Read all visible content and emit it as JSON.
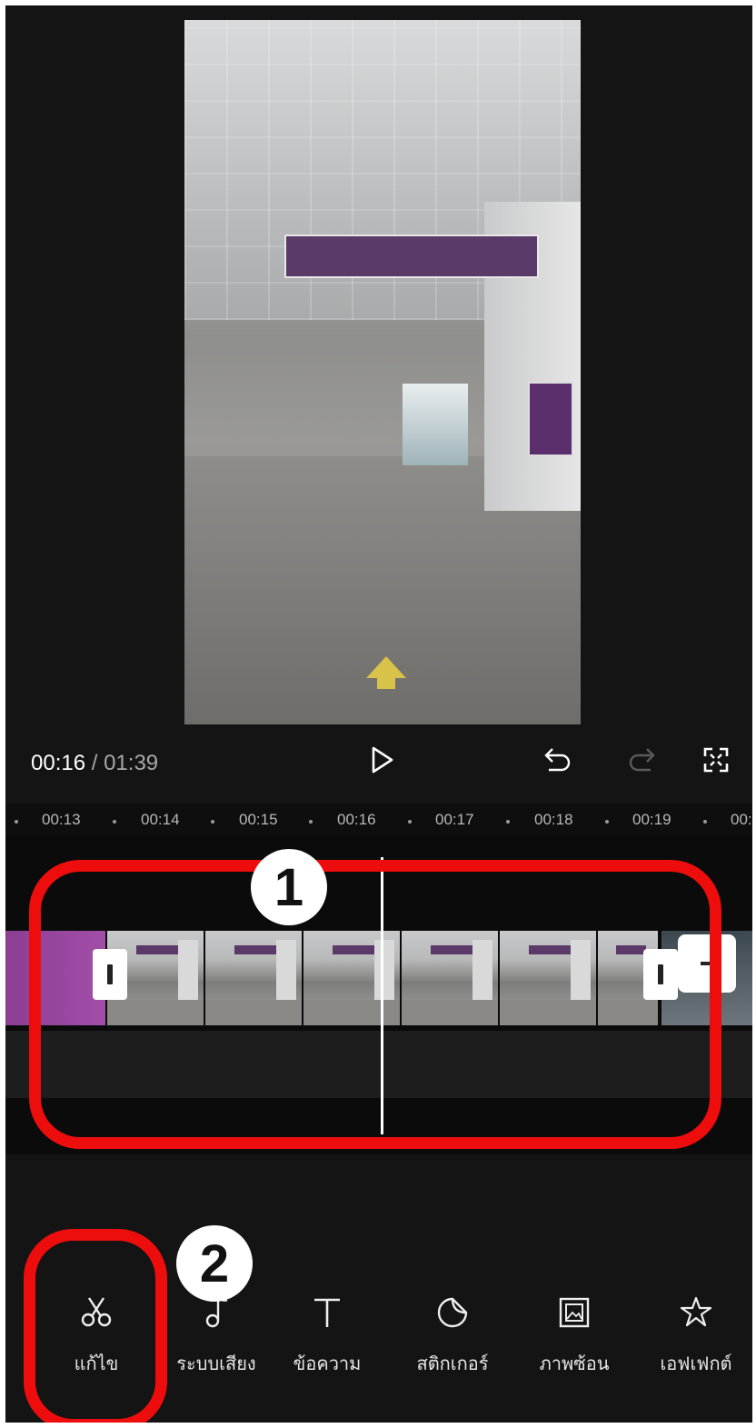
{
  "player": {
    "current_time": "00:16",
    "separator": " / ",
    "total_time": "01:39"
  },
  "ruler": {
    "ticks": [
      "00:13",
      "00:14",
      "00:15",
      "00:16",
      "00:17",
      "00:18",
      "00:19",
      "00:"
    ]
  },
  "annotations": {
    "badge_1": "1",
    "badge_2": "2",
    "accent_color": "#ee0d0d"
  },
  "toolbar": {
    "items": [
      {
        "label": "แก้ไข",
        "icon": "scissors-icon"
      },
      {
        "label": "ระบบเสียง",
        "icon": "music-note-icon"
      },
      {
        "label": "ข้อความ",
        "icon": "text-icon"
      },
      {
        "label": "สติกเกอร์",
        "icon": "sticker-icon"
      },
      {
        "label": "ภาพซ้อน",
        "icon": "overlay-icon"
      },
      {
        "label": "เอฟเฟกต์",
        "icon": "effects-star-icon"
      }
    ]
  }
}
